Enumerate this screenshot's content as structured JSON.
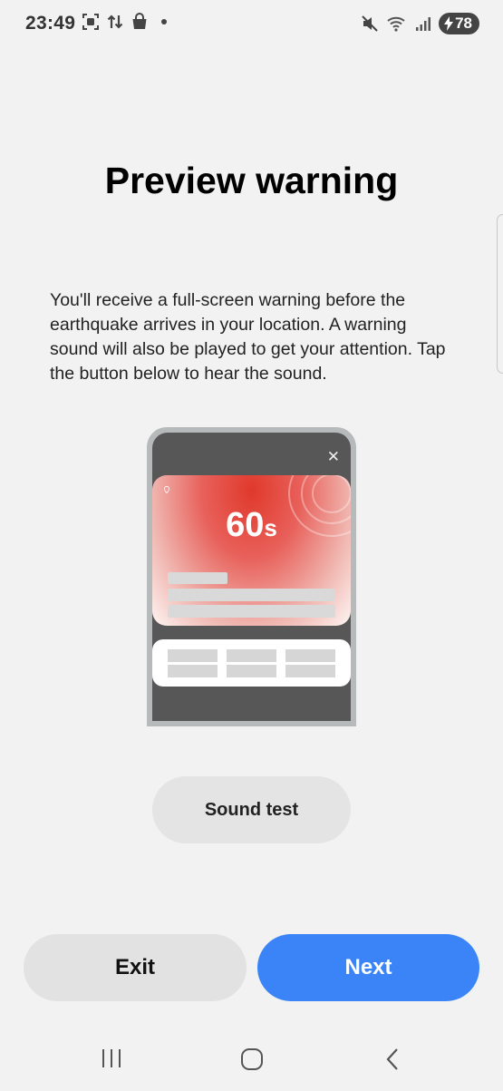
{
  "status_bar": {
    "time": "23:49",
    "battery": "78",
    "icons_left": [
      "screenshot-icon",
      "data-transfer-icon",
      "shopping-bag-icon",
      "notification-dot-icon"
    ],
    "icons_right": [
      "mute-vibrate-icon",
      "wifi-icon",
      "signal-icon",
      "battery-icon"
    ]
  },
  "page": {
    "title": "Preview warning",
    "description": "You'll receive a full-screen warning before the earthquake arrives in your location. A warning sound will also be played to get your attention. Tap the button below to hear the sound."
  },
  "illustration": {
    "countdown_value": "60",
    "countdown_unit": "s",
    "alert_color": "#e0392b"
  },
  "buttons": {
    "sound_test": "Sound test",
    "exit": "Exit",
    "next": "Next",
    "accent": "#3a84f7"
  },
  "nav": [
    "recent-apps-icon",
    "home-icon",
    "back-icon"
  ]
}
